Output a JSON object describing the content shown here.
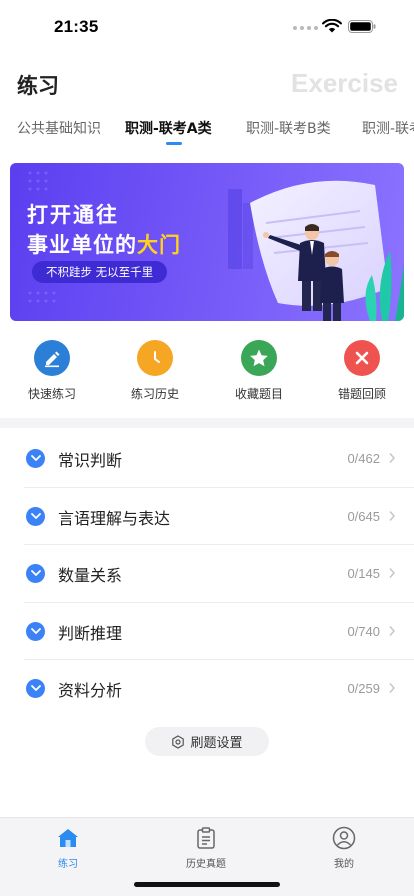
{
  "status_bar": {
    "time": "21:35"
  },
  "header": {
    "title": "练习",
    "title_en": "Exercise"
  },
  "tabs": [
    {
      "label": "公共基础知识",
      "active": false
    },
    {
      "label": "职测-联考A类",
      "active": true
    },
    {
      "label": "职测-联考B类",
      "active": false
    },
    {
      "label": "职测-联考",
      "active": false
    }
  ],
  "banner": {
    "line1": "打开通往",
    "line2_prefix": "事业单位的",
    "line2_highlight": "大门",
    "slogan": "不积跬步 无以至千里"
  },
  "shortcuts": [
    {
      "label": "快速练习",
      "icon": "pencil-icon",
      "color": "#2b7fd6"
    },
    {
      "label": "练习历史",
      "icon": "clock-icon",
      "color": "#f5a623"
    },
    {
      "label": "收藏题目",
      "icon": "star-icon",
      "color": "#3aa657"
    },
    {
      "label": "错题回顾",
      "icon": "close-icon",
      "color": "#ef5350"
    }
  ],
  "list": [
    {
      "label": "常识判断",
      "count": "0/462"
    },
    {
      "label": "言语理解与表达",
      "count": "0/645"
    },
    {
      "label": "数量关系",
      "count": "0/145"
    },
    {
      "label": "判断推理",
      "count": "0/740"
    },
    {
      "label": "资料分析",
      "count": "0/259"
    }
  ],
  "settings_button": {
    "label": "刷题设置"
  },
  "tabbar": [
    {
      "label": "练习",
      "icon": "home-icon",
      "active": true
    },
    {
      "label": "历史真题",
      "icon": "clipboard-icon",
      "active": false
    },
    {
      "label": "我的",
      "icon": "user-icon",
      "active": false
    }
  ],
  "colors": {
    "accent": "#2b8bf0",
    "list_chevron": "#3b82f6",
    "banner_highlight": "#ffd21a"
  }
}
